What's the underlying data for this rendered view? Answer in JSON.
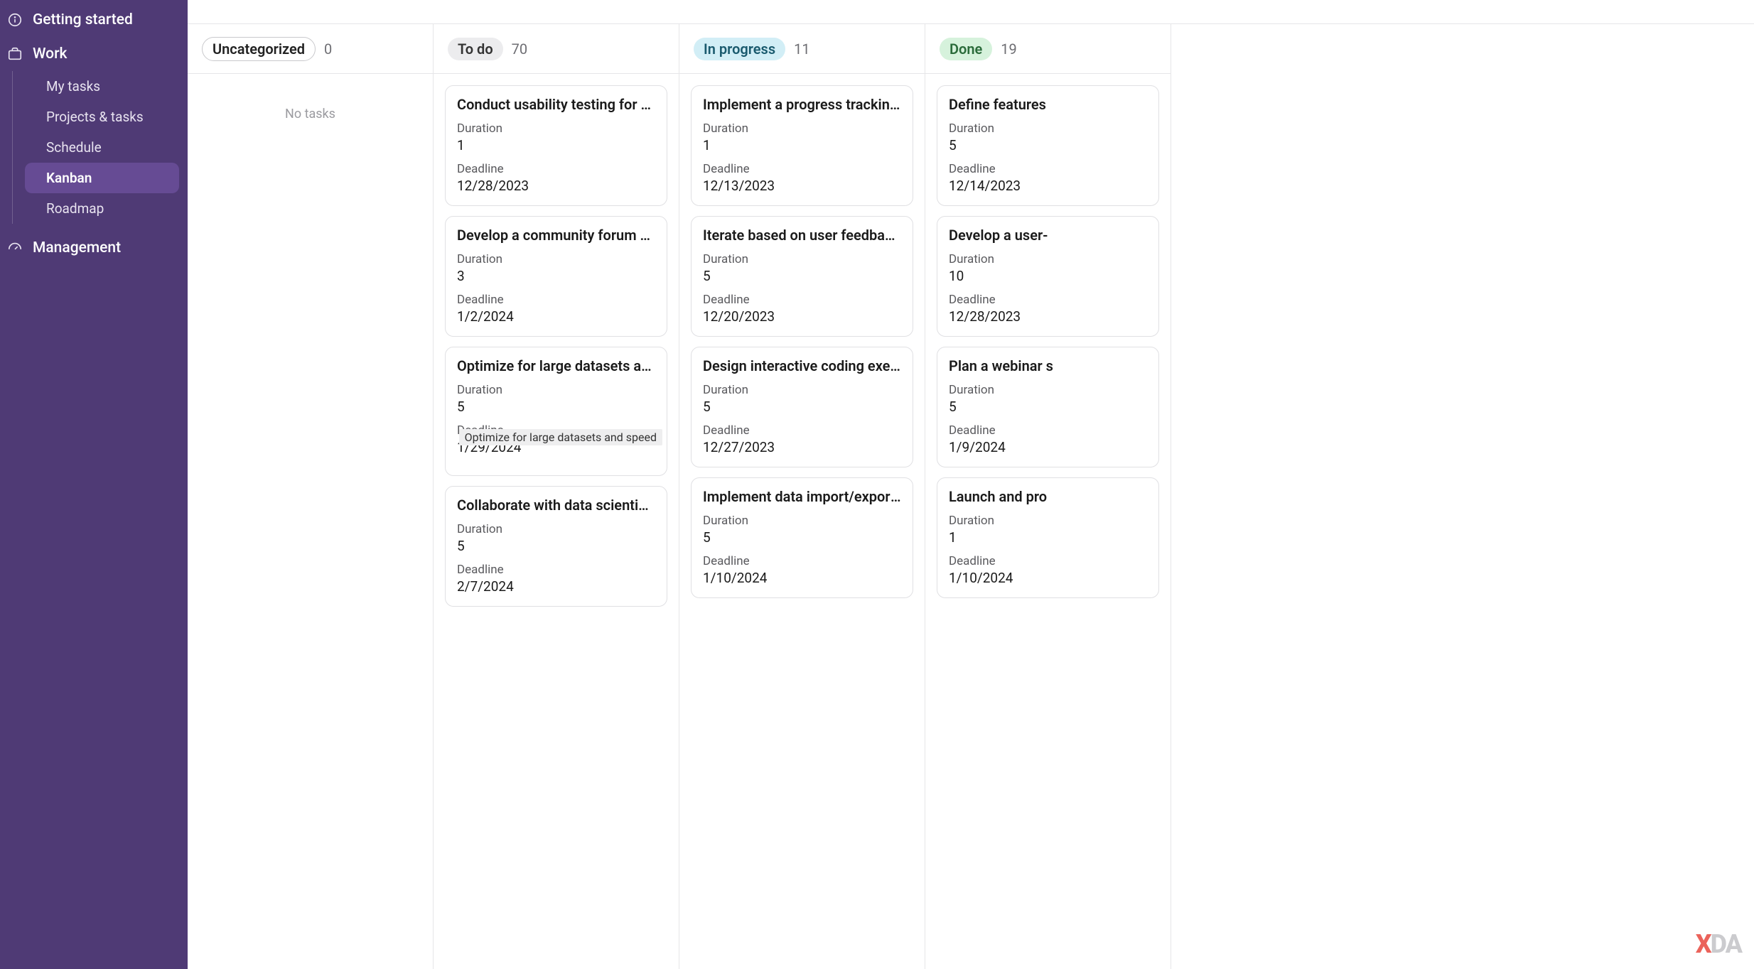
{
  "sidebar": {
    "getting_started": "Getting started",
    "work": "Work",
    "work_items": [
      {
        "label": "My tasks"
      },
      {
        "label": "Projects & tasks"
      },
      {
        "label": "Schedule"
      },
      {
        "label": "Kanban",
        "active": true
      },
      {
        "label": "Roadmap"
      }
    ],
    "management": "Management"
  },
  "labels": {
    "duration": "Duration",
    "deadline": "Deadline",
    "no_tasks": "No tasks",
    "tooltip_optimize": "Optimize for large datasets and speed"
  },
  "columns": [
    {
      "name": "Uncategorized",
      "pill_class": "pill-gray-outline",
      "count": 0,
      "empty": true,
      "cards": []
    },
    {
      "name": "To do",
      "pill_class": "pill-gray",
      "count": 70,
      "cards": [
        {
          "title": "Conduct usability testing for c...",
          "duration": "1",
          "deadline": "12/28/2023"
        },
        {
          "title": "Develop a community forum f...",
          "duration": "3",
          "deadline": "1/2/2024"
        },
        {
          "title": "Optimize for large datasets an...",
          "duration": "5",
          "deadline": "1/29/2024",
          "tooltip": true
        },
        {
          "title": "Collaborate with data scientis...",
          "duration": "5",
          "deadline": "2/7/2024"
        }
      ]
    },
    {
      "name": "In progress",
      "pill_class": "pill-blue",
      "count": 11,
      "cards": [
        {
          "title": "Implement a progress trackin...",
          "duration": "1",
          "deadline": "12/13/2023"
        },
        {
          "title": "Iterate based on user feedback.",
          "duration": "5",
          "deadline": "12/20/2023"
        },
        {
          "title": "Design interactive coding exer...",
          "duration": "5",
          "deadline": "12/27/2023"
        },
        {
          "title": "Implement data import/export...",
          "duration": "5",
          "deadline": "1/10/2024"
        }
      ]
    },
    {
      "name": "Done",
      "pill_class": "pill-green",
      "count": 19,
      "cards": [
        {
          "title": "Define features",
          "duration": "5",
          "deadline": "12/14/2023"
        },
        {
          "title": "Develop a user-",
          "duration": "10",
          "deadline": "12/28/2023"
        },
        {
          "title": "Plan a webinar s",
          "duration": "5",
          "deadline": "1/9/2024"
        },
        {
          "title": "Launch and pro",
          "duration": "1",
          "deadline": "1/10/2024"
        }
      ]
    }
  ],
  "watermark": {
    "a": "X",
    "b": "DA"
  }
}
